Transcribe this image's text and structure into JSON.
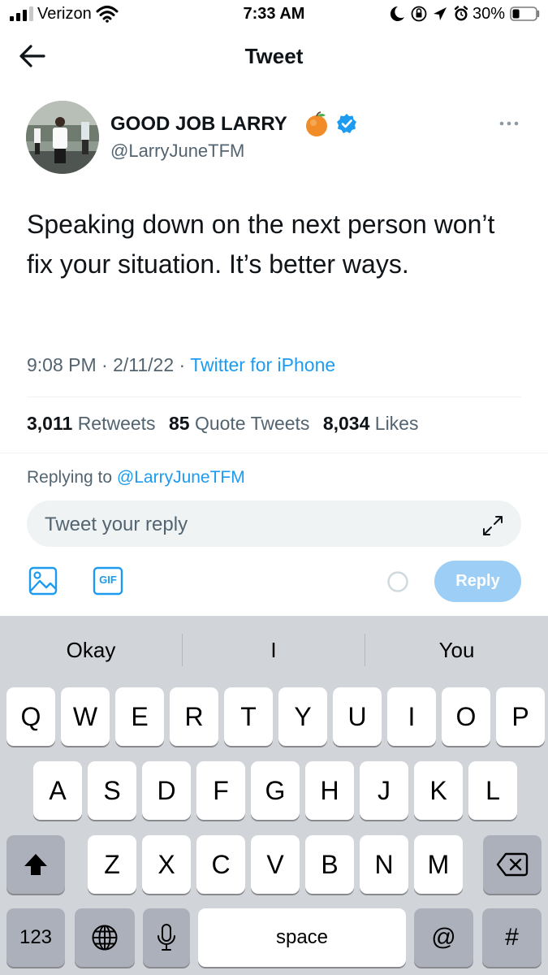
{
  "status_bar": {
    "carrier": "Verizon",
    "time": "7:33 AM",
    "battery": "30%",
    "battery_level": 0.3
  },
  "header": {
    "title": "Tweet",
    "back_icon": "arrow-left-icon"
  },
  "tweet": {
    "display_name": "GOOD JOB LARRY",
    "emoji": "🍊",
    "handle": "@LarryJuneTFM",
    "text": "Speaking down on the next person won’t fix your situation. It’s better ways.",
    "time": "9:08 PM",
    "date": "2/11/22",
    "separator": "·",
    "source": "Twitter for iPhone",
    "stats": {
      "retweets_count": "3,011",
      "retweets_label": "Retweets",
      "quotes_count": "85",
      "quotes_label": "Quote Tweets",
      "likes_count": "8,034",
      "likes_label": "Likes"
    }
  },
  "composer": {
    "replying_prefix": "Replying to",
    "replying_to": "@LarryJuneTFM",
    "placeholder": "Tweet your reply",
    "gif_label": "GIF",
    "reply_button": "Reply"
  },
  "keyboard": {
    "predictions": [
      "Okay",
      "I",
      "You"
    ],
    "row1": [
      "Q",
      "W",
      "E",
      "R",
      "T",
      "Y",
      "U",
      "I",
      "O",
      "P"
    ],
    "row2": [
      "A",
      "S",
      "D",
      "F",
      "G",
      "H",
      "J",
      "K",
      "L"
    ],
    "row3": [
      "Z",
      "X",
      "C",
      "V",
      "B",
      "N",
      "M"
    ],
    "numbers_key": "123",
    "space_key": "space",
    "at_key": "@",
    "hash_key": "#"
  },
  "colors": {
    "accent": "#1d9bf0",
    "reply_button_disabled": "#9ccef6",
    "secondary_text": "#536471",
    "keyboard_bg": "#d1d4d9"
  }
}
